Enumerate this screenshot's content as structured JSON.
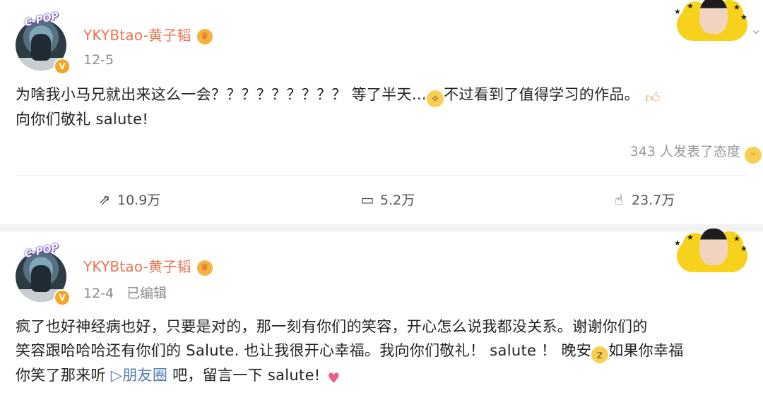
{
  "posts": [
    {
      "author": "YKYBtao-黄子韬",
      "avatar_badge": "C-POP",
      "verified_mark": "V",
      "crown_icon": "♕",
      "date": "12-5",
      "edited": "",
      "content_line1_a": "为啥我小马兄就出来这么一会？？？？？？？？？ 等了半天…",
      "content_line1_b": "不过看到了值得学习的作品。",
      "content_line2": "向你们敬礼 salute!",
      "reactions_text": "343 人发表了态度",
      "actions": {
        "repost": "10.9万",
        "comment": "5.2万",
        "like": "23.7万"
      }
    },
    {
      "author": "YKYBtao-黄子韬",
      "avatar_badge": "C-POP",
      "verified_mark": "V",
      "crown_icon": "♕",
      "date": "12-4",
      "edited": "已编辑",
      "content_line1": "疯了也好神经病也好，只要是对的，那一刻有你们的笑容，开心怎么说我都没关系。谢谢你们的",
      "content_line2_a": "笑容跟哈哈哈还有你们的 Salute. 也让我很开心幸福。我向你们敬礼！ salute ！ 晚安",
      "content_line2_b": "如果你幸福",
      "content_line3_a": "你笑了那来听 ",
      "link_text": "▷朋友圈",
      "content_line3_b": " 吧，留言一下 salute!"
    }
  ],
  "icons": {
    "repost": "repost-icon",
    "comment": "comment-icon",
    "like": "thumbs-up-icon",
    "menu": "chevron-down-icon"
  }
}
